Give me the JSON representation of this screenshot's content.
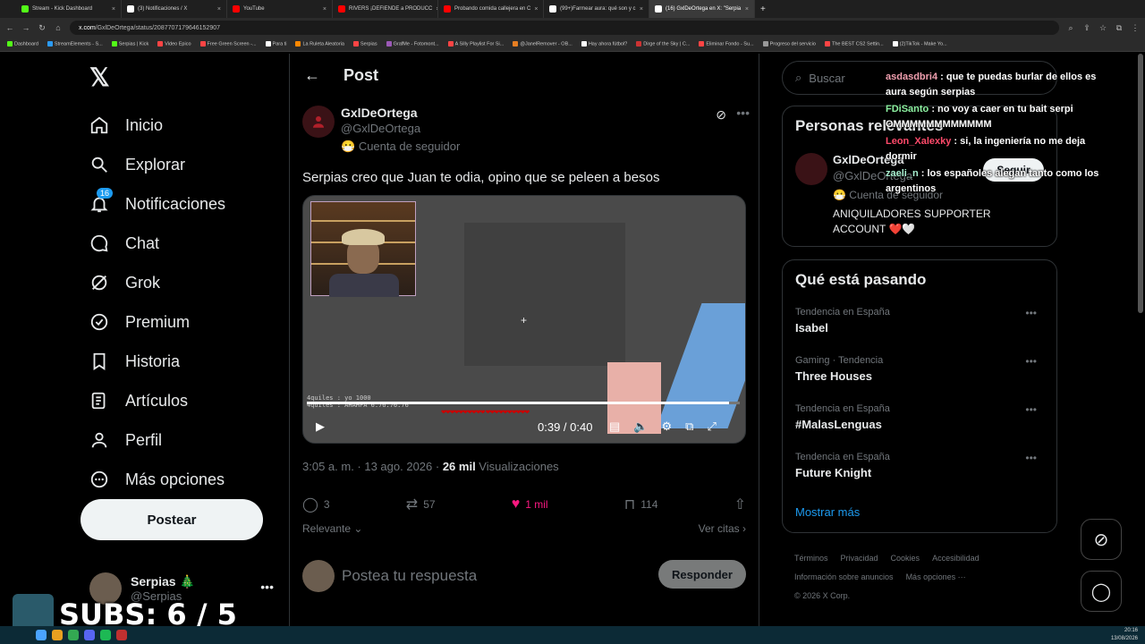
{
  "browser": {
    "tabs": [
      {
        "label": "Stream - Kick Dashboard",
        "color": "#53fc18"
      },
      {
        "label": "(3) Notificaciones / X",
        "color": "#ffffff"
      },
      {
        "label": "YouTube",
        "color": "#ff0000"
      },
      {
        "label": "RIVERS ¡DEFIENDE a PRODUCC",
        "color": "#ff0000"
      },
      {
        "label": "Probando comida callejera en C",
        "color": "#ff0000"
      },
      {
        "label": "(99+)Farmear aura: qué son y c",
        "color": "#ffffff"
      },
      {
        "label": "(16) GxlDeOrtega en X: \"Serpia",
        "color": "#ffffff",
        "active": true
      }
    ],
    "url_domain": "x.com",
    "url_path": "/GxlDeOrtega/status/2087707179646152907",
    "bookmarks": [
      "Dashboard",
      "StreamElements - S...",
      "Serpias | Kick",
      "Video Epico",
      "Free Green Screen -...",
      "Para ti",
      "La Ruleta Aleatoria",
      "Serpias",
      "GrafMe - Fotomont...",
      "A Silly Playlist For Si...",
      "@JanelRemover - OB...",
      "Hay ahora fútbol?",
      "Dirge of the Sky | C...",
      "Eliminar Fondo - Su...",
      "Progreso del servicio",
      "The BEST CS2 Settin...",
      "(2)TikTok - Make Yo..."
    ]
  },
  "sidebar": {
    "items": [
      {
        "label": "Inicio",
        "icon": "home-icon"
      },
      {
        "label": "Explorar",
        "icon": "search-icon"
      },
      {
        "label": "Notificaciones",
        "icon": "bell-icon",
        "badge": "16"
      },
      {
        "label": "Chat",
        "icon": "chat-icon"
      },
      {
        "label": "Grok",
        "icon": "grok-icon"
      },
      {
        "label": "Premium",
        "icon": "verified-icon"
      },
      {
        "label": "Historia",
        "icon": "bookmark-icon"
      },
      {
        "label": "Artículos",
        "icon": "article-icon"
      },
      {
        "label": "Perfil",
        "icon": "person-icon"
      },
      {
        "label": "Más opciones",
        "icon": "more-icon"
      }
    ],
    "post_button": "Postear",
    "account": {
      "name": "Serpias 🎄",
      "handle": "@Serpias"
    }
  },
  "main": {
    "header_title": "Post",
    "tweet": {
      "name": "GxlDeOrtega",
      "handle": "@GxlDeOrtega",
      "label": "Cuenta de seguidor",
      "text": "Serpias creo que Juan te odia, opino que se peleen a besos",
      "video_time": "0:39 / 0:40",
      "video_progress": 0.975,
      "video_chat": "4quiles : yo 1000\n4quiles : AHAHFA 6.76.76.76",
      "time": "3:05 a. m. · 13 ago. 2026 · ",
      "views_count": "26 mil",
      "views_label": " Visualizaciones",
      "replies": "3",
      "reposts": "57",
      "likes": "1 mil",
      "bookmarks": "114"
    },
    "sort_label": "Relevante",
    "quotes_label": "Ver citas",
    "reply_placeholder": "Postea tu respuesta",
    "reply_button": "Responder"
  },
  "right": {
    "search_placeholder": "Buscar",
    "who_title": "Personas relevantes",
    "who": {
      "name": "GxlDeOrtega",
      "handle": "@GxlDeOrtega",
      "label": "Cuenta de seguidor",
      "bio": "ANIQUILADORES SUPPORTER ACCOUNT ❤️🤍",
      "follow": "Seguir"
    },
    "trends_title": "Qué está pasando",
    "trends": [
      {
        "context": "Tendencia en España",
        "name": "Isabel"
      },
      {
        "context": "Gaming · Tendencia",
        "name": "Three Houses"
      },
      {
        "context": "Tendencia en España",
        "name": "#MalasLenguas"
      },
      {
        "context": "Tendencia en España",
        "name": "Future Knight"
      }
    ],
    "show_more": "Mostrar más",
    "footer": [
      "Términos",
      "Privacidad",
      "Cookies",
      "Accesibilidad",
      "Información sobre anuncios",
      "Más opciones ···",
      "© 2026 X Corp."
    ]
  },
  "stream_chat": [
    {
      "user": "asdasdbri4",
      "text": " : que te puedas burlar de ellos es aura según serpias"
    },
    {
      "user": "FDiSanto",
      "text": " : no voy a caer en tu bait serpi OMMMMMMMMMMMM"
    },
    {
      "user": "Leon_Xalexky",
      "text": " : si, la ingeniería no me deja dormir"
    },
    {
      "user": "zaeli_n",
      "text": " : los españoles alegan tanto como los argentinos"
    }
  ],
  "overlay": {
    "subs": "SUBS: 6 / 5"
  },
  "clock": {
    "time": "20:16",
    "date": "13/08/2026"
  }
}
